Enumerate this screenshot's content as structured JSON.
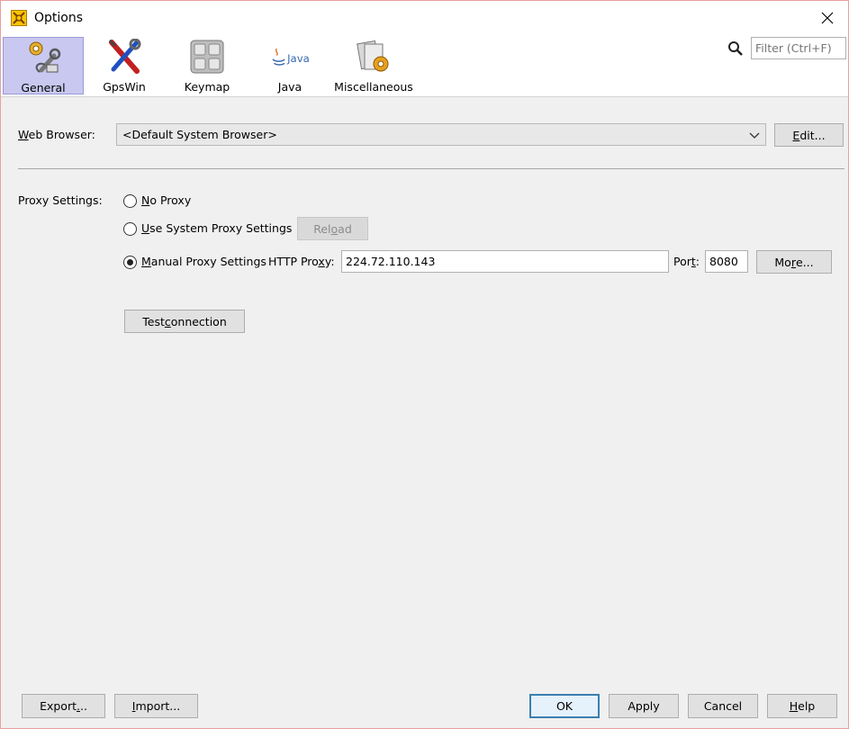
{
  "window": {
    "title": "Options",
    "close_glyph": "✕"
  },
  "categories": [
    {
      "label": "General",
      "icon": "general-settings-icon",
      "selected": true
    },
    {
      "label": "GpsWin",
      "icon": "tools-icon"
    },
    {
      "label": "Keymap",
      "icon": "keyboard-icon"
    },
    {
      "label": "Java",
      "icon": "java-logo-icon"
    },
    {
      "label": "Miscellaneous",
      "icon": "miscellaneous-icon"
    }
  ],
  "filter": {
    "placeholder": "Filter (Ctrl+F)"
  },
  "web_browser": {
    "label_u": "W",
    "label_rest": "eb Browser:",
    "value": "<Default System Browser>",
    "edit_u": "E",
    "edit_rest": "dit..."
  },
  "proxy": {
    "label": "Proxy Settings:",
    "no_proxy_u": "N",
    "no_proxy_rest": "o Proxy",
    "system_u": "U",
    "system_rest": "se System Proxy Settings",
    "reload_pre": "Rel",
    "reload_u": "o",
    "reload_post": "ad",
    "manual_u": "M",
    "manual_rest": "anual Proxy Settings",
    "http_pre": "HTTP Pro",
    "http_u": "x",
    "http_post": "y:",
    "http_value": "224.72.110.143",
    "port_pre": "Por",
    "port_u": "t",
    "port_post": ":",
    "port_value": "8080",
    "more_pre": "Mo",
    "more_u": "r",
    "more_post": "e...",
    "selected": "manual"
  },
  "test_connection": {
    "pre": "Test ",
    "u": "c",
    "post": "onnection"
  },
  "footer": {
    "export_pre": "Export",
    "export_u": ".",
    "export_post": "..",
    "import_u": "I",
    "import_rest": "mport...",
    "ok": "OK",
    "apply": "Apply",
    "cancel": "Cancel",
    "help_u": "H",
    "help_rest": "elp"
  },
  "colors": {
    "selected_tab_bg": "#c8c8f0",
    "default_button_border": "#3c7fb1"
  }
}
